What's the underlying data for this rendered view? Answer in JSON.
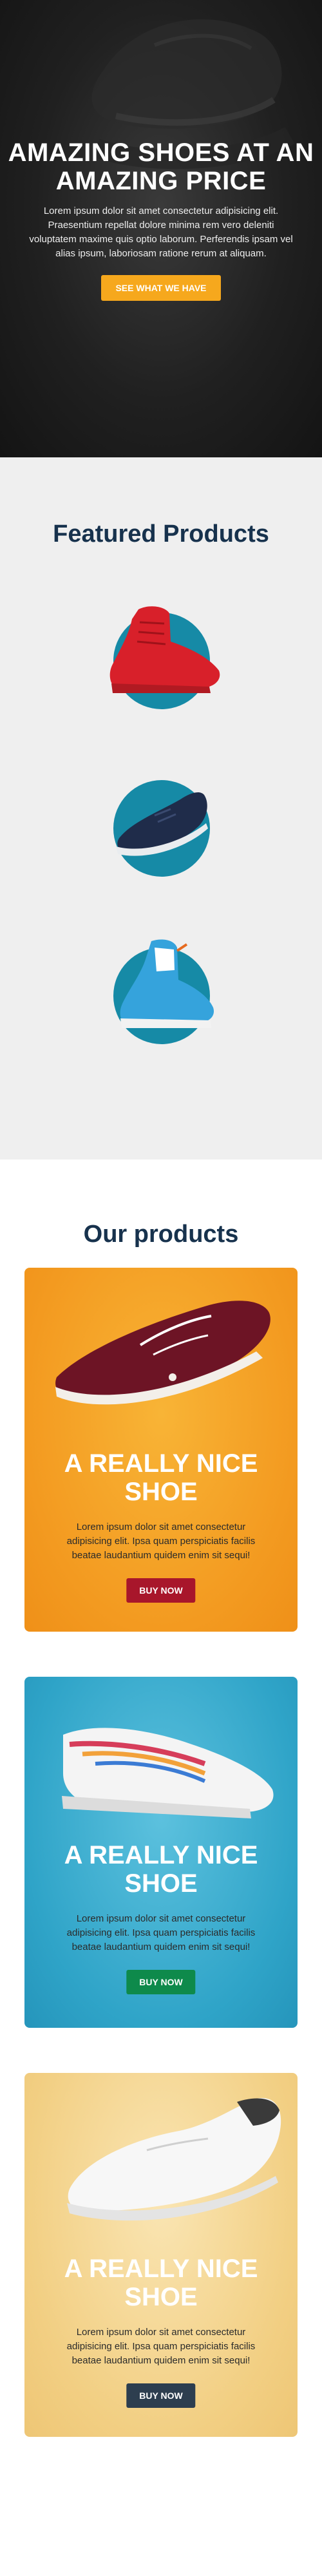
{
  "hero": {
    "title": "AMAZING SHOES AT AN AMAZING PRICE",
    "text": "Lorem ipsum dolor sit amet consectetur adipisicing elit. Praesentium repellat dolore minima rem vero deleniti voluptatem maxime quis optio laborum. Perferendis ipsam vel alias ipsum, laboriosam ratione rerum at aliquam.",
    "button": "SEE WHAT WE HAVE",
    "accent": "#f6a81d"
  },
  "featured": {
    "title": "Featured Products",
    "circle_color": "#168aa6",
    "items": [
      {
        "icon": "red-sneaker-image"
      },
      {
        "icon": "navy-running-shoe-image"
      },
      {
        "icon": "blue-high-top-sneaker-image"
      }
    ]
  },
  "products": {
    "title": "Our products",
    "cards": [
      {
        "title": "A REALLY NICE SHOE",
        "text": "Lorem ipsum dolor sit amet consectetur adipisicing elit. Ipsa quam perspiciatis facilis beatae laudantium quidem enim sit sequi!",
        "button": "BUY NOW",
        "bg": "#f39a20",
        "button_color": "#a8162b",
        "icon": "burgundy-skate-shoe-image"
      },
      {
        "title": "A REALLY NICE SHOE",
        "text": "Lorem ipsum dolor sit amet consectetur adipisicing elit. Ipsa quam perspiciatis facilis beatae laudantium quidem enim sit sequi!",
        "button": "BUY NOW",
        "bg": "#2fa4c8",
        "button_color": "#0e8a4b",
        "icon": "white-patterned-sneaker-image"
      },
      {
        "title": "A REALLY NICE SHOE",
        "text": "Lorem ipsum dolor sit amet consectetur adipisicing elit. Ipsa quam perspiciatis facilis beatae laudantium quidem enim sit sequi!",
        "button": "BUY NOW",
        "bg": "#f2cf83",
        "button_color": "#2d3e4f",
        "icon": "white-leather-sneaker-image"
      }
    ]
  }
}
